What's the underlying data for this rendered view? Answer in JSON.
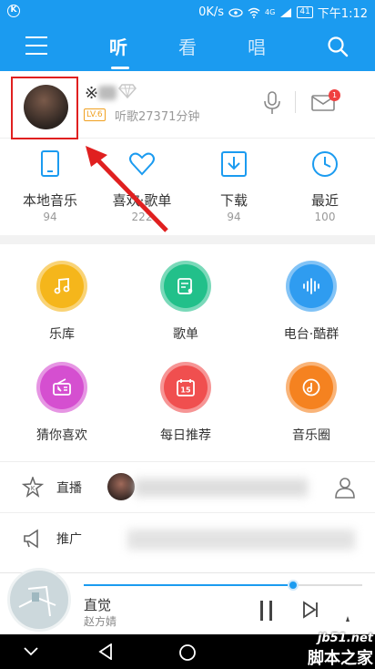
{
  "status_bar": {
    "network": "0K/s",
    "signal_label": "4G",
    "battery": "41",
    "time": "下午1:12"
  },
  "header": {
    "tabs": [
      "听",
      "看",
      "唱"
    ],
    "active_tab": "听",
    "accent_color": "#1b9bf0"
  },
  "profile": {
    "name_partial": "※",
    "level": "LV.6",
    "listen_time": "听歌27371分钟",
    "mail_badge": "1"
  },
  "quick_links": [
    {
      "icon": "phone-icon",
      "label": "本地音乐",
      "count": "94"
    },
    {
      "icon": "heart-icon",
      "label": "喜欢·歌单",
      "count": "222"
    },
    {
      "icon": "download-icon",
      "label": "下载",
      "count": "94"
    },
    {
      "icon": "clock-icon",
      "label": "最近",
      "count": "100"
    }
  ],
  "grid": [
    {
      "icon": "music-note-icon",
      "label": "乐库",
      "color": "#f5b61b"
    },
    {
      "icon": "playlist-icon",
      "label": "歌单",
      "color": "#22c08a"
    },
    {
      "icon": "sound-wave-icon",
      "label": "电台·酷群",
      "color": "#2f9cf0"
    },
    {
      "icon": "radio-icon",
      "label": "猜你喜欢",
      "color": "#d54fd0"
    },
    {
      "icon": "calendar-icon",
      "label": "每日推荐",
      "color": "#f04f4f",
      "badge": "15"
    },
    {
      "icon": "music-circle-icon",
      "label": "音乐圈",
      "color": "#f58220"
    }
  ],
  "rows": [
    {
      "icon": "live-icon",
      "label": "直播"
    },
    {
      "icon": "megaphone-icon",
      "label": "推广"
    }
  ],
  "player": {
    "song": "直觉",
    "artist": "赵方婧",
    "progress_fraction": 0.75
  },
  "watermark": {
    "line1": "jb51.net",
    "line2": "脚本之家"
  }
}
